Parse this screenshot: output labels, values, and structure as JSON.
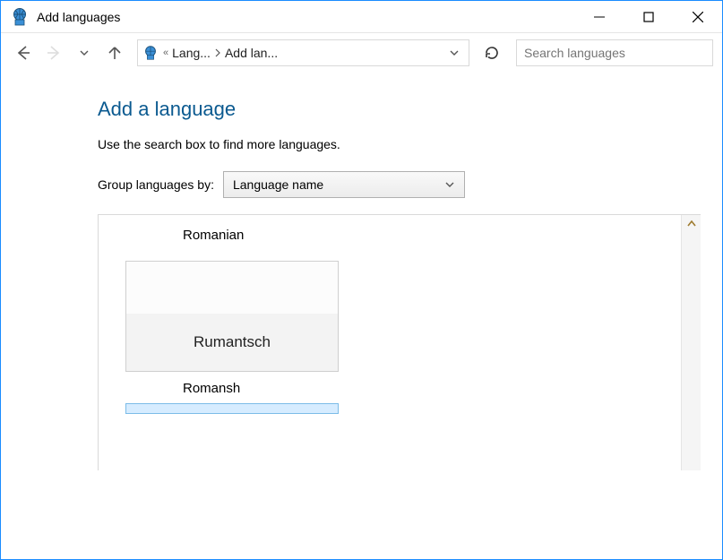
{
  "window": {
    "title": "Add languages"
  },
  "toolbar": {
    "breadcrumb": {
      "crumb1": "Lang...",
      "crumb2": "Add lan..."
    },
    "search_placeholder": "Search languages"
  },
  "page": {
    "heading": "Add a language",
    "hint": "Use the search box to find more languages.",
    "group_label": "Group languages by:",
    "group_selected": "Language name"
  },
  "languages": {
    "group_header": "Romanian",
    "tile_native": "Rumantsch",
    "tile_english": "Romansh"
  }
}
